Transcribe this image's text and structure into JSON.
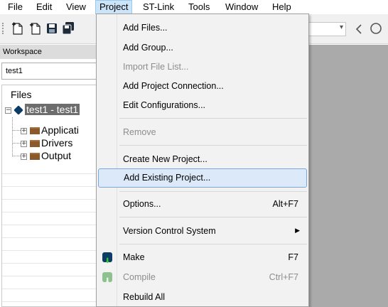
{
  "menubar": {
    "items": [
      "File",
      "Edit",
      "View",
      "Project",
      "ST-Link",
      "Tools",
      "Window",
      "Help"
    ],
    "active": "Project"
  },
  "toolbar": {
    "icons": [
      "new-file-icon",
      "new-workspace-icon",
      "save-icon",
      "save-all-icon"
    ],
    "nav_icons": [
      "chevron-down-icon",
      "back-arrow-icon",
      "search-icon"
    ]
  },
  "workspace": {
    "title": "Workspace",
    "config": "test1",
    "tree_header": "Files",
    "project": "test1 - test1",
    "project_visible": "test1 - test1",
    "groups": [
      "Applicati",
      "Drivers",
      "Output"
    ]
  },
  "project_menu": {
    "items": [
      {
        "label": "Add Files...",
        "shortcut": "",
        "enabled": true
      },
      {
        "label": "Add Group...",
        "shortcut": "",
        "enabled": true
      },
      {
        "label": "Import File List...",
        "shortcut": "",
        "enabled": false
      },
      {
        "label": "Add Project Connection...",
        "shortcut": "",
        "enabled": true
      },
      {
        "label": "Edit Configurations...",
        "shortcut": "",
        "enabled": true
      },
      {
        "label": "Remove",
        "shortcut": "",
        "enabled": false
      },
      {
        "label": "Create New Project...",
        "shortcut": "",
        "enabled": true
      },
      {
        "label": "Add Existing Project...",
        "shortcut": "",
        "enabled": true,
        "highlighted": true
      },
      {
        "label": "Options...",
        "shortcut": "Alt+F7",
        "enabled": true
      },
      {
        "label": "Version Control System",
        "shortcut": "",
        "enabled": true,
        "submenu": true
      },
      {
        "label": "Make",
        "shortcut": "F7",
        "enabled": true,
        "icon": "make-icon"
      },
      {
        "label": "Compile",
        "shortcut": "Ctrl+F7",
        "enabled": false,
        "icon": "compile-icon"
      },
      {
        "label": "Rebuild All",
        "shortcut": "",
        "enabled": true
      }
    ]
  },
  "colors": {
    "menu_highlight": "#dbe9f9",
    "menu_highlight_border": "#7aa7de",
    "menubar_active": "#cce4f7",
    "disabled_text": "#8d8d8d",
    "mdi_background": "#aaaaaa"
  }
}
